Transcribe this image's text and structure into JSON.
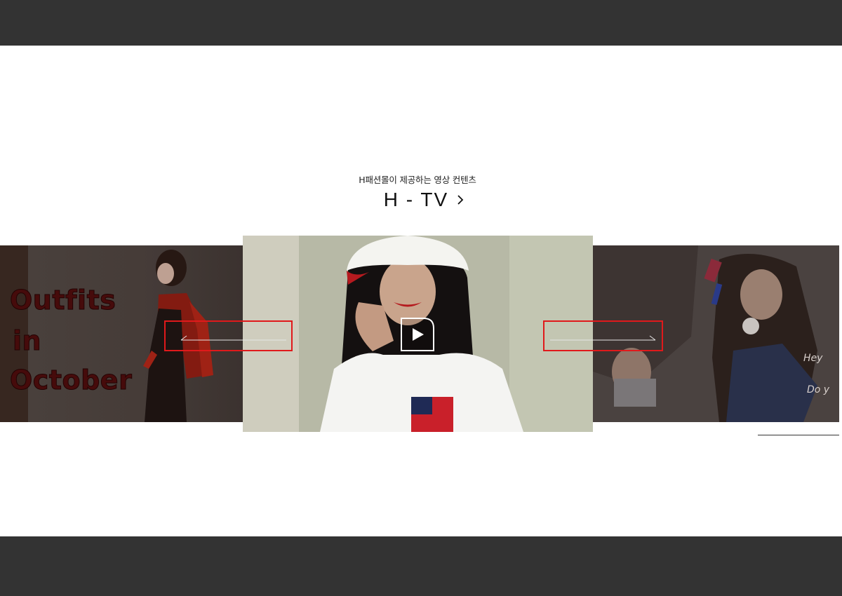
{
  "header": {
    "subtitle": "H패션몰이 제공하는 영상 컨텐츠",
    "title": "H - TV"
  },
  "slides": {
    "left": {
      "text_lines": [
        "Outfits",
        "in",
        "October"
      ]
    },
    "center": {
      "play_icon": "play-icon"
    },
    "right": {
      "handwriting": [
        "Hey",
        "Do y"
      ]
    }
  },
  "navigation": {
    "prev_icon": "arrow-left-icon",
    "next_icon": "arrow-right-icon",
    "highlight_color": "#e0191b"
  },
  "colors": {
    "top_bar": "#333333",
    "bottom_bar": "#333333",
    "background": "#ffffff"
  }
}
